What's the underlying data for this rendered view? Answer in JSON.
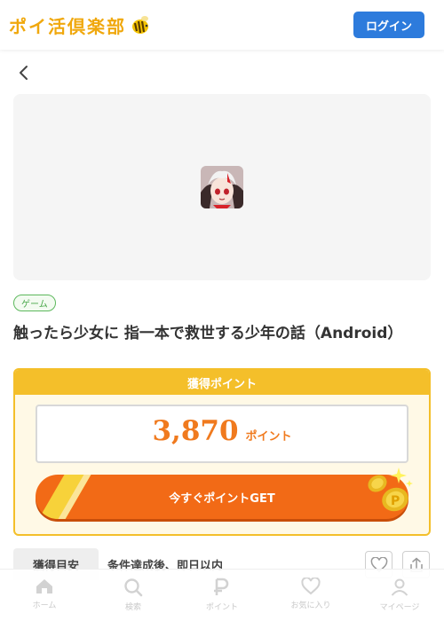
{
  "header": {
    "logo_text": "ポイ活倶楽部",
    "login_label": "ログイン"
  },
  "offer": {
    "category": "ゲーム",
    "title": "触ったら少女に 指一本で救世する少年の話（Android）"
  },
  "points": {
    "heading": "獲得ポイント",
    "value": "3,870",
    "unit": "ポイント",
    "cta_label": "今すぐポイントGET"
  },
  "info": {
    "label": "獲得目安",
    "value": "条件達成後、即日以内"
  },
  "nav": {
    "items": [
      {
        "label": "ホーム",
        "icon": "home-icon"
      },
      {
        "label": "検索",
        "icon": "search-icon"
      },
      {
        "label": "ポイント",
        "icon": "points-icon"
      },
      {
        "label": "お気に入り",
        "icon": "heart-icon"
      },
      {
        "label": "マイページ",
        "icon": "user-icon"
      }
    ]
  },
  "colors": {
    "brand_blue": "#2d7bdc",
    "accent_orange": "#f26a16",
    "accent_yellow": "#f4bf2a",
    "tag_green": "#5cb85c"
  }
}
